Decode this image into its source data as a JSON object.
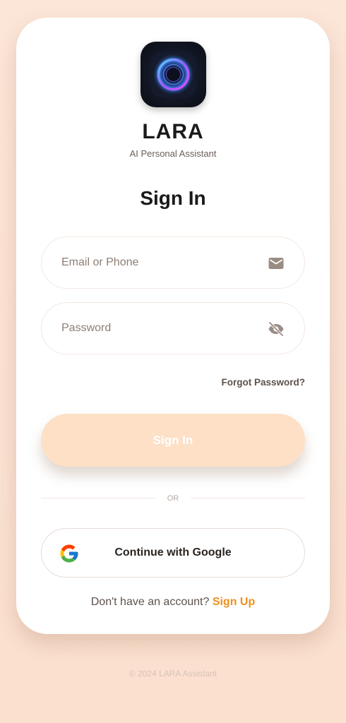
{
  "app": {
    "name": "LARA",
    "subtitle": "AI Personal Assistant"
  },
  "form": {
    "title": "Sign In",
    "email": {
      "placeholder": "Email or Phone",
      "value": "",
      "icon": "mail-icon"
    },
    "password": {
      "placeholder": "Password",
      "value": "",
      "icon": "eye-off-icon"
    },
    "forgot_label": "Forgot Password?",
    "submit_label": "Sign In"
  },
  "divider_label": "OR",
  "google": {
    "label": "Continue with Google",
    "icon": "google-icon"
  },
  "signup": {
    "prompt": "Don't have an account?",
    "link_label": "Sign Up"
  },
  "footer": "© 2024 LARA Assistant",
  "colors": {
    "background": "#fce6d8",
    "accent": "#f0901e",
    "submit_button": "#fde0c6"
  }
}
